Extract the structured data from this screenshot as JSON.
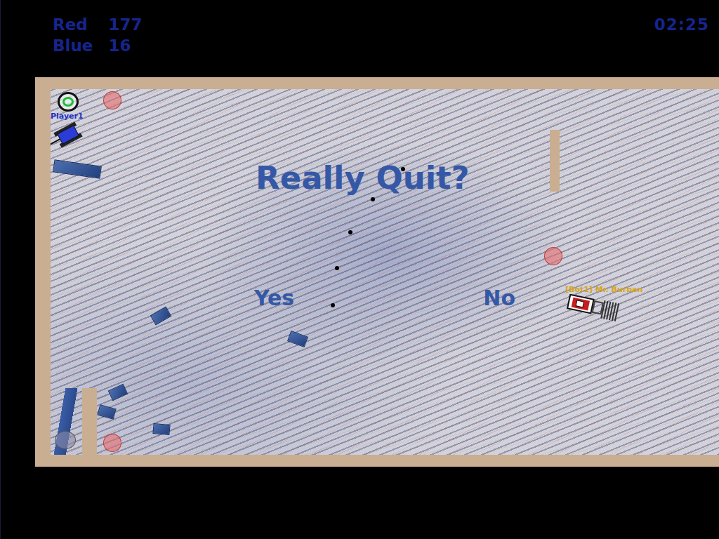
{
  "scoreboard": {
    "teams": [
      {
        "team": "Red",
        "points": "177"
      },
      {
        "team": "Blue",
        "points": "16"
      }
    ],
    "timer": "02:25"
  },
  "dialog": {
    "title": "Really Quit?",
    "options": [
      {
        "label": "Yes",
        "selected": false
      },
      {
        "label": "No",
        "selected": false
      }
    ]
  },
  "players": [
    {
      "name": "Player1",
      "kind": "human",
      "color": "#2a3bd6"
    },
    {
      "name": "[Bot1] Mr. Burban",
      "kind": "bot",
      "color": "#c81e1e"
    }
  ]
}
